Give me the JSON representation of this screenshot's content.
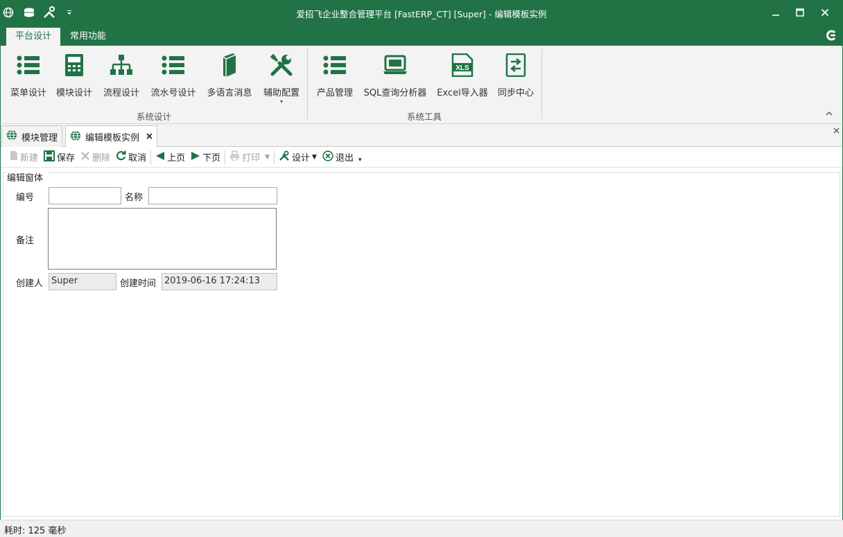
{
  "window": {
    "title": "爱招飞企业整合管理平台 [FastERP_CT] [Super] - 编辑模板实例",
    "accent": "#217346"
  },
  "ribbon": {
    "tabs": [
      {
        "label": "平台设计",
        "active": true
      },
      {
        "label": "常用功能",
        "active": false
      }
    ],
    "groups": [
      {
        "label": "系统设计",
        "buttons": [
          {
            "label": "菜单设计",
            "icon": "list-icon"
          },
          {
            "label": "模块设计",
            "icon": "calculator-icon"
          },
          {
            "label": "流程设计",
            "icon": "sitemap-icon"
          },
          {
            "label": "流水号设计",
            "icon": "list-icon"
          },
          {
            "label": "多语言消息",
            "icon": "book-icon"
          },
          {
            "label": "辅助配置",
            "icon": "wrench-icon"
          }
        ]
      },
      {
        "label": "系统工具",
        "buttons": [
          {
            "label": "产品管理",
            "icon": "list-icon"
          },
          {
            "label": "SQL查询分析器",
            "icon": "laptop-icon"
          },
          {
            "label": "Excel导入器",
            "icon": "xls-icon"
          },
          {
            "label": "同步中心",
            "icon": "sync-icon"
          }
        ]
      }
    ]
  },
  "doc_tabs": [
    {
      "label": "模块管理",
      "active": false
    },
    {
      "label": "编辑模板实例",
      "active": true
    }
  ],
  "toolbar": {
    "new": "新建",
    "save": "保存",
    "delete": "删除",
    "cancel": "取消",
    "prev": "上页",
    "next": "下页",
    "print": "打印",
    "design": "设计",
    "exit": "退出"
  },
  "form": {
    "legend": "编辑窗体",
    "code_label": "编号",
    "code_value": "",
    "name_label": "名称",
    "name_value": "",
    "remark_label": "备注",
    "remark_value": "",
    "creator_label": "创建人",
    "creator_value": "Super",
    "created_time_label": "创建时间",
    "created_time_value": "2019-06-16 17:24:13"
  },
  "status": {
    "text": "耗时: 125 毫秒"
  }
}
